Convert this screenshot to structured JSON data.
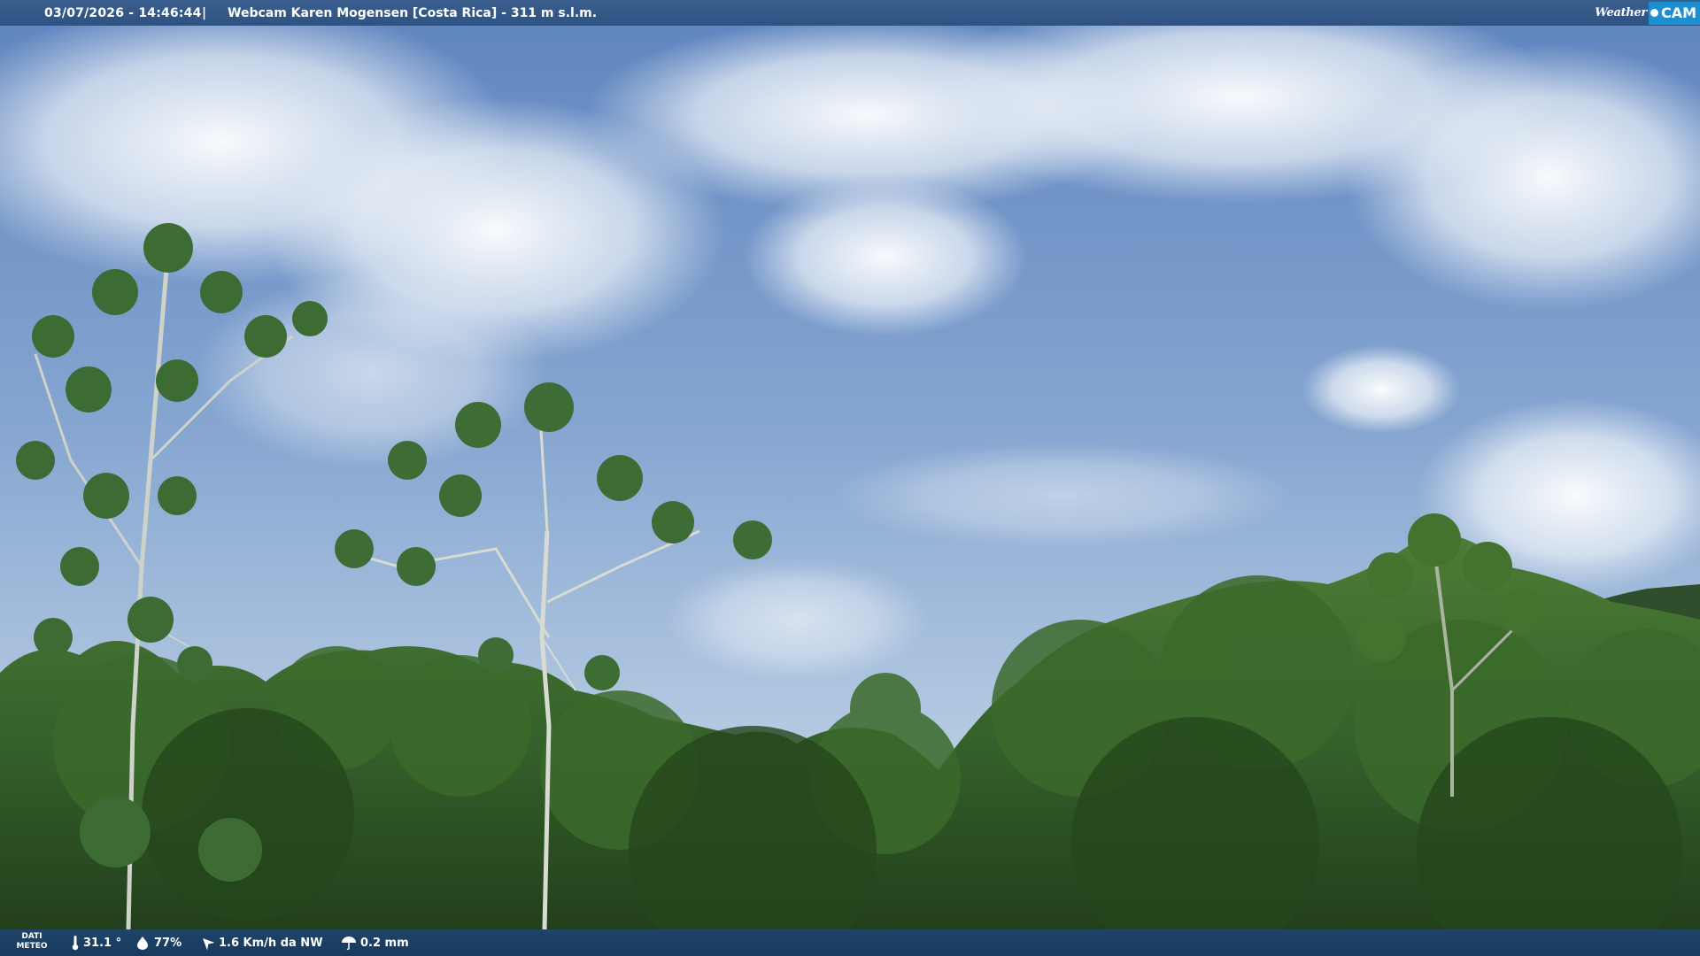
{
  "header": {
    "datetime": "03/07/2026 - 14:46:44",
    "separator": "|",
    "title": "Webcam Karen Mogensen [Costa Rica]  - 311 m s.l.m."
  },
  "logo": {
    "weather": "Weather",
    "cam": "CAM"
  },
  "footer": {
    "label_line1": "DATI",
    "label_line2": "METEO",
    "temperature": "31.1 °",
    "humidity": "77%",
    "wind": "1.6 Km/h da NW",
    "rain": "0.2 mm"
  },
  "colors": {
    "sky_top": "#5f85bf",
    "sky_bottom": "#b9cde3",
    "forest_dark": "#1f3a1a",
    "forest_mid": "#3d6b2a",
    "logo_accent": "#1c8fd1"
  }
}
